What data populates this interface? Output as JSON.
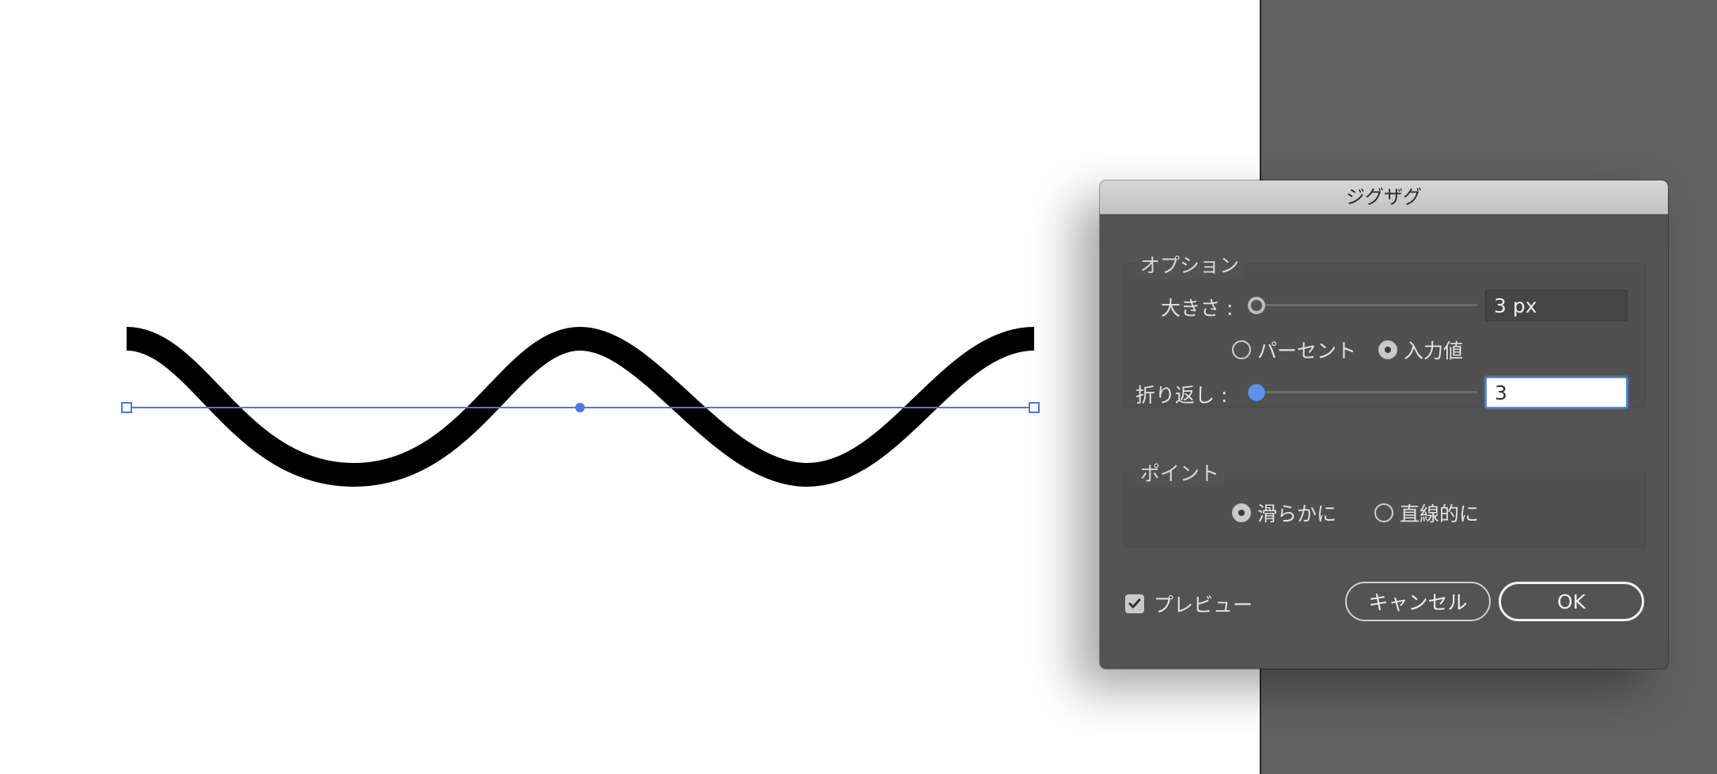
{
  "dialog": {
    "title": "ジグザグ",
    "options_group": {
      "legend": "オプション",
      "size_label": "大きさ :",
      "size_value": "3 px",
      "unit_mode": {
        "percent_label": "パーセント",
        "absolute_label": "入力値",
        "selected": "absolute"
      },
      "ridges_label": "折り返し :",
      "ridges_value": "3"
    },
    "points_group": {
      "legend": "ポイント",
      "smooth_label": "滑らかに",
      "corner_label": "直線的に",
      "selected": "smooth"
    },
    "preview": {
      "label": "プレビュー",
      "checked": true
    },
    "cancel_label": "キャンセル",
    "ok_label": "OK"
  },
  "colors": {
    "selection": "#4a78e8",
    "stroke": "#000000",
    "pasteboard": "#616161",
    "dialog_bg": "#535353",
    "accent": "#5b93e6"
  }
}
